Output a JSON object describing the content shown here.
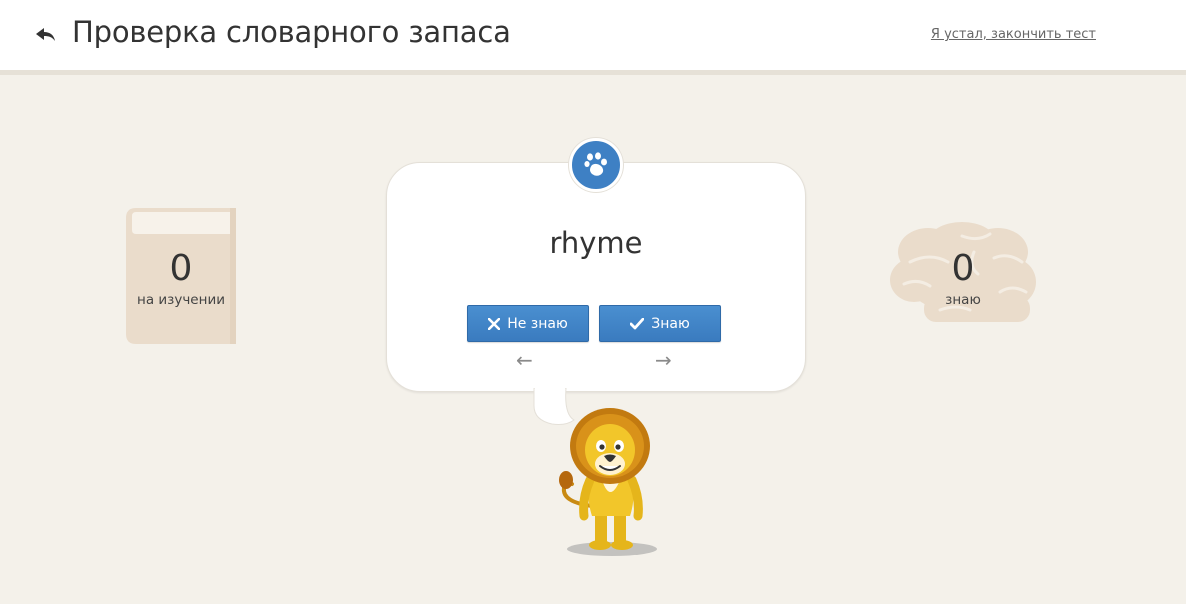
{
  "header": {
    "title": "Проверка словарного запаса",
    "quit_link": "Я устал, закончить тест",
    "back_icon": "back-arrow-icon"
  },
  "counters": {
    "learning": {
      "value": "0",
      "label": "на изучении",
      "icon": "book-icon"
    },
    "known": {
      "value": "0",
      "label": "знаю",
      "icon": "brain-icon"
    }
  },
  "card": {
    "badge_icon": "paw-icon",
    "word": "rhyme",
    "buttons": {
      "dont_know": "Не знаю",
      "know": "Знаю"
    },
    "prev_arrow": "←",
    "next_arrow": "→"
  },
  "mascot": {
    "icon": "lion-mascot"
  },
  "colors": {
    "background": "#f4f1ea",
    "accent_blue": "#3e80c4",
    "counter_beige": "#eadccb"
  }
}
